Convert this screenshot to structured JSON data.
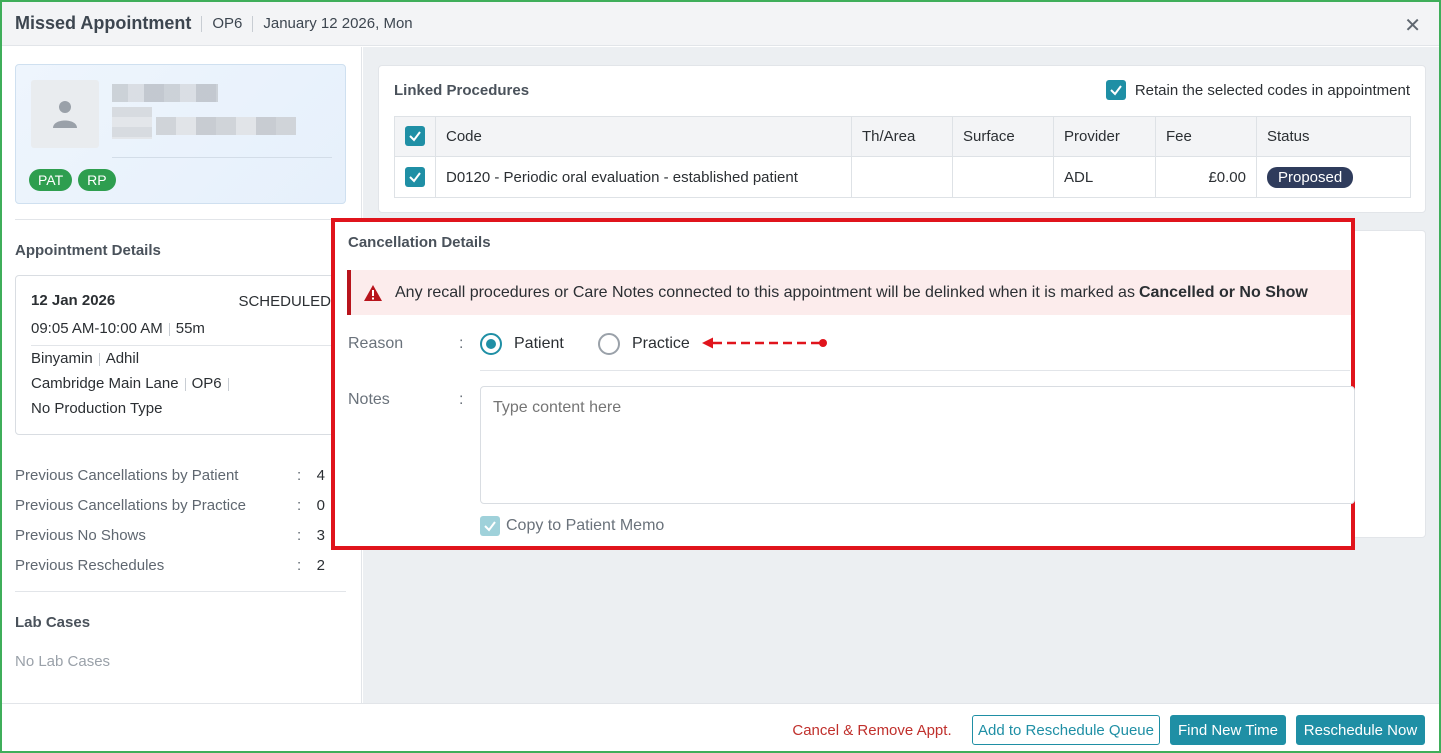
{
  "header": {
    "title": "Missed Appointment",
    "operatory": "OP6",
    "date": "January 12 2026, Mon"
  },
  "patient": {
    "badges": [
      "PAT",
      "RP"
    ]
  },
  "appointment": {
    "section_title": "Appointment Details",
    "date": "12 Jan 2026",
    "status": "SCHEDULED",
    "time": "09:05 AM-10:00 AM",
    "duration": "55m",
    "provider_first": "Binyamin",
    "provider_second": "Adhil",
    "location": "Cambridge Main Lane",
    "operatory": "OP6",
    "production_type": "No Production Type"
  },
  "stats": [
    {
      "label": "Previous Cancellations by Patient",
      "value": "4"
    },
    {
      "label": "Previous Cancellations by Practice",
      "value": "0"
    },
    {
      "label": "Previous No Shows",
      "value": "3"
    },
    {
      "label": "Previous Reschedules",
      "value": "2"
    }
  ],
  "lab": {
    "title": "Lab Cases",
    "empty": "No Lab Cases"
  },
  "linked": {
    "title": "Linked Procedures",
    "retain_label": "Retain the selected codes in appointment",
    "columns": [
      "Code",
      "Th/Area",
      "Surface",
      "Provider",
      "Fee",
      "Status"
    ],
    "rows": [
      {
        "code": "D0120 - Periodic oral evaluation - established patient",
        "area": "",
        "surface": "",
        "provider": "ADL",
        "fee": "£0.00",
        "status": "Proposed"
      }
    ]
  },
  "cancellation": {
    "title": "Cancellation Details",
    "alert_text": "Any recall procedures or Care Notes connected to this appointment will be delinked when it is marked as",
    "alert_bold": "Cancelled or No Show",
    "reason_label": "Reason",
    "colon": ":",
    "reason_options": [
      "Patient",
      "Practice"
    ],
    "reason_selected": "Patient",
    "notes_label": "Notes",
    "notes_placeholder": "Type content here",
    "copy_memo_label": "Copy to Patient Memo"
  },
  "footer": {
    "cancel_remove": "Cancel & Remove Appt.",
    "add_queue": "Add to Reschedule Queue",
    "find_time": "Find New Time",
    "reschedule_now": "Reschedule Now"
  },
  "colors": {
    "accent": "#1f8fa5",
    "badge": "#2e9e4f",
    "highlight": "#e0141c",
    "danger_text": "#c0302c"
  }
}
